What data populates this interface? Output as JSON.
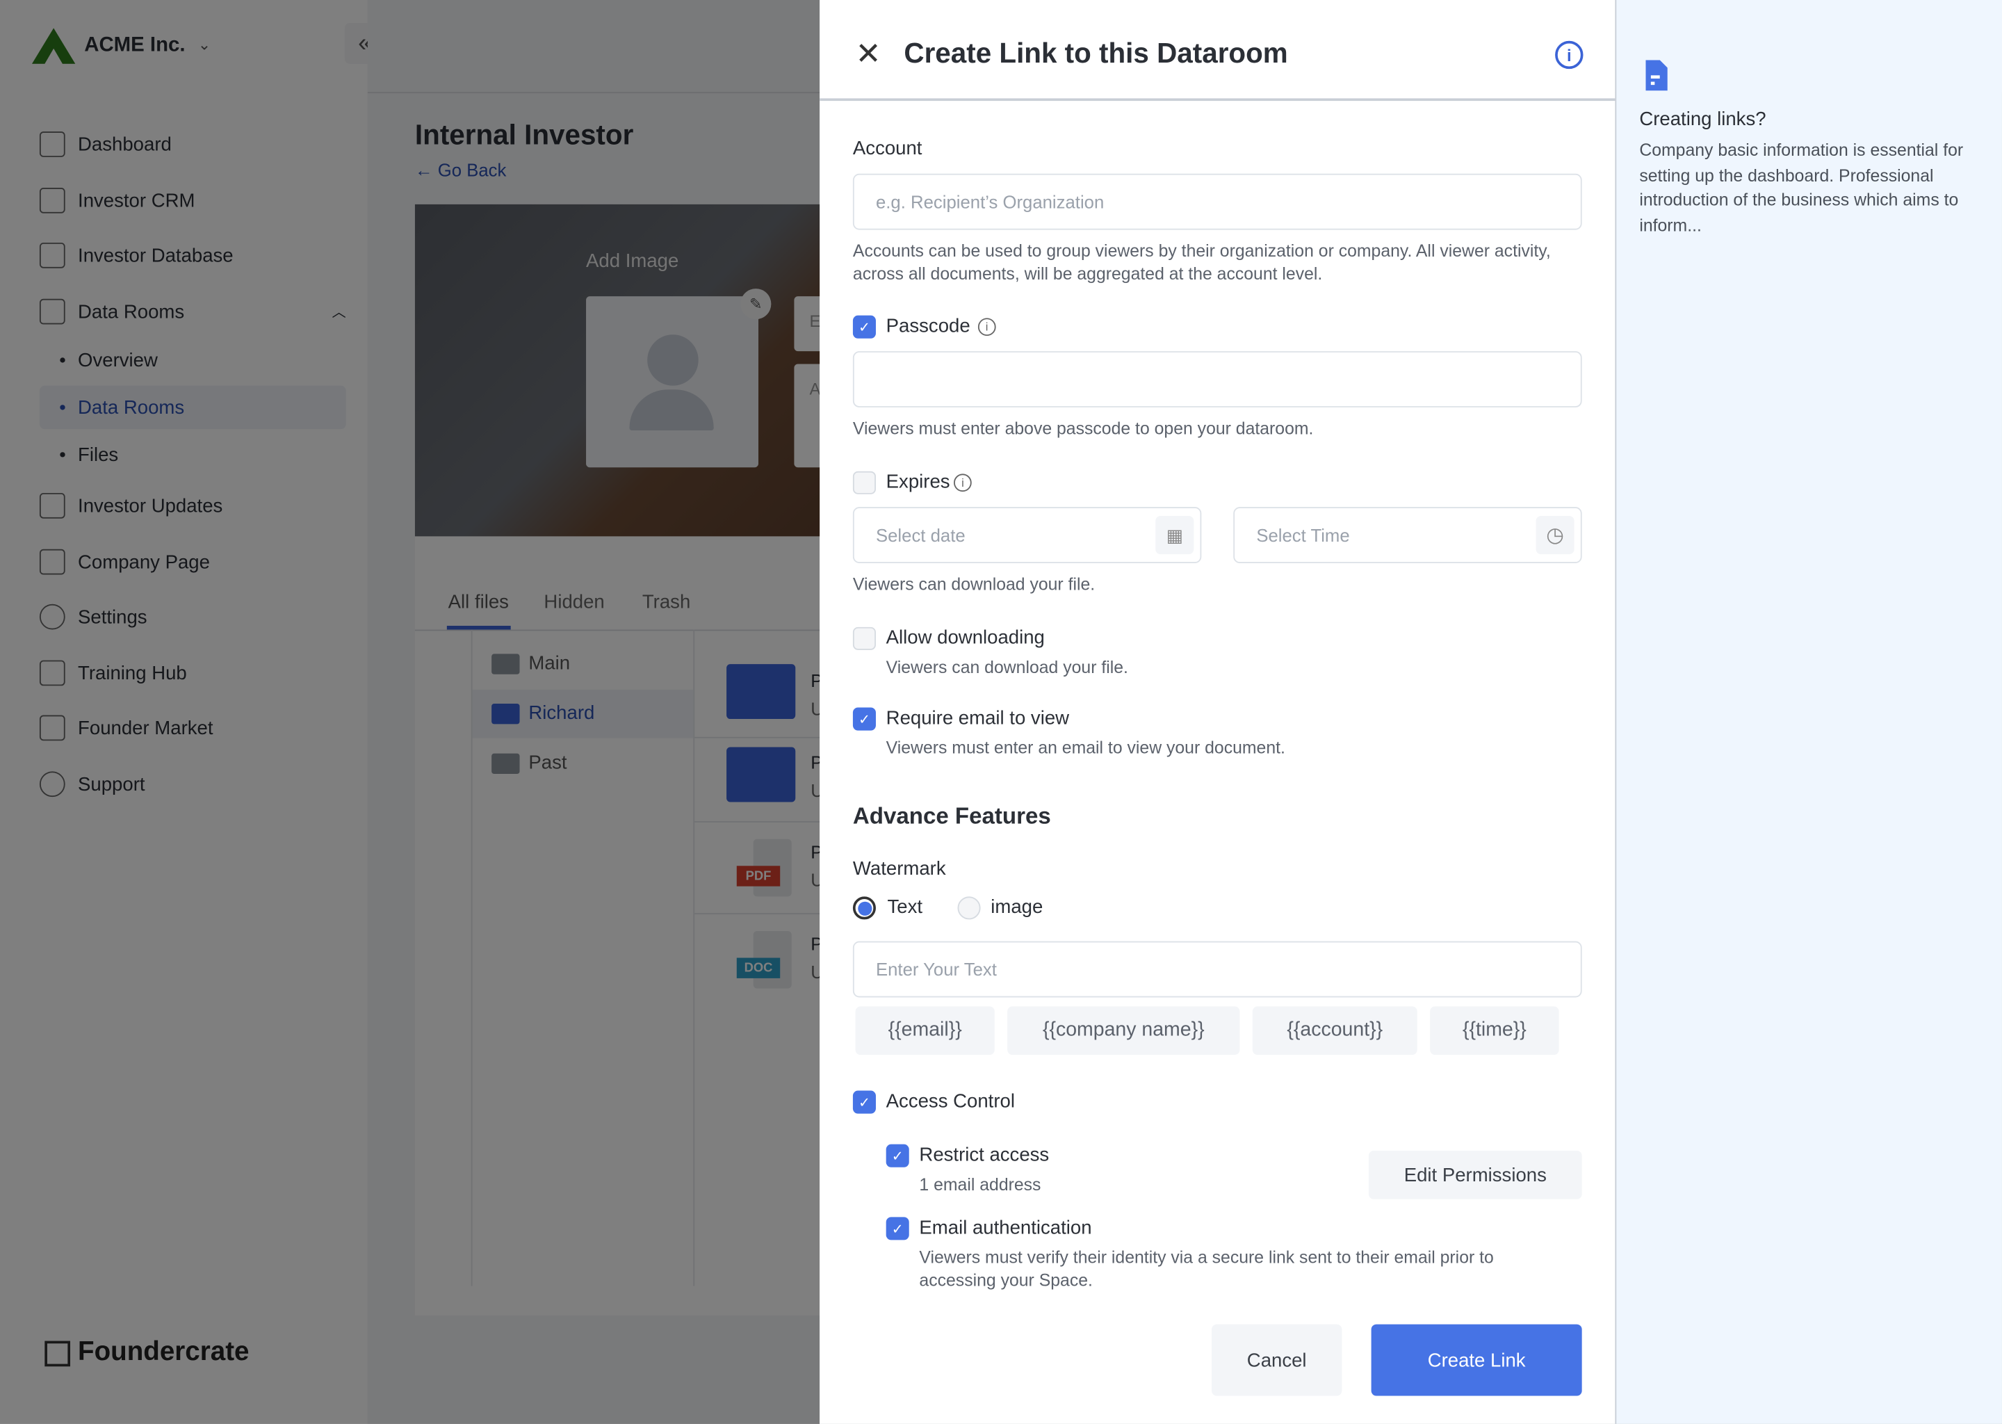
{
  "sidebar": {
    "company": "ACME Inc.",
    "items": [
      {
        "label": "Dashboard",
        "icon": "dashboard-icon"
      },
      {
        "label": "Investor CRM",
        "icon": "presentation-icon"
      },
      {
        "label": "Investor Database",
        "icon": "database-icon"
      },
      {
        "label": "Data Rooms",
        "icon": "building-icon"
      },
      {
        "label": "Investor Updates",
        "icon": "document-check-icon"
      },
      {
        "label": "Company Page",
        "icon": "page-icon"
      },
      {
        "label": "Settings",
        "icon": "gear-icon"
      },
      {
        "label": "Training Hub",
        "icon": "training-icon"
      },
      {
        "label": "Founder Market",
        "icon": "market-icon"
      },
      {
        "label": "Support",
        "icon": "help-icon"
      }
    ],
    "subitems": [
      {
        "label": "Overview"
      },
      {
        "label": "Data Rooms",
        "active": true
      },
      {
        "label": "Files"
      }
    ],
    "brand": "Foundercrate"
  },
  "main": {
    "title": "Internal Investor",
    "go_back": "Go Back",
    "add_image": "Add Image",
    "card_fragments": [
      "E",
      "A"
    ],
    "tabs": [
      "All files",
      "Hidden",
      "Trash"
    ],
    "folders": [
      {
        "label": "Main"
      },
      {
        "label": "Richard",
        "active": true
      },
      {
        "label": "Past"
      }
    ],
    "files": [
      {
        "type": "folder",
        "fragment": "P",
        "sub": "U"
      },
      {
        "type": "folder",
        "fragment": "P",
        "sub": "U"
      },
      {
        "type": "PDF",
        "fragment": "P",
        "sub": "U"
      },
      {
        "type": "DOC",
        "fragment": "P",
        "sub": "U"
      }
    ]
  },
  "modal": {
    "title": "Create Link to this Dataroom",
    "account_label": "Account",
    "account_placeholder": "e.g. Recipient’s Organization",
    "account_help": "Accounts can be used to group viewers by their organization or company. All viewer activity, across all documents, will be aggregated at the account level.",
    "passcode_label": "Passcode",
    "passcode_checked": true,
    "passcode_help": "Viewers must enter above passcode to open your dataroom.",
    "expires_label": "Expires",
    "expires_checked": false,
    "date_placeholder": "Select date",
    "time_placeholder": "Select Time",
    "expires_help": "Viewers can download your file.",
    "download_label": "Allow downloading",
    "download_checked": false,
    "download_help": "Viewers can download your file.",
    "email_label": "Require email to view",
    "email_checked": true,
    "email_help": "Viewers must enter an email to view your document.",
    "advance_title": "Advance Features",
    "watermark_label": "Watermark",
    "watermark_options": [
      "Text",
      "image"
    ],
    "watermark_selected": "Text",
    "watermark_placeholder": "Enter Your Text",
    "chips": [
      "{{email}}",
      "{{company name}}",
      "{{account}}",
      "{{time}}"
    ],
    "access_label": "Access Control",
    "access_checked": true,
    "restrict_label": "Restrict access",
    "restrict_sub": "1 email address",
    "edit_permissions": "Edit Permissions",
    "auth_label": "Email authentication",
    "auth_help": "Viewers must verify their identity via a secure link sent to their email prior to accessing your Space.",
    "cancel": "Cancel",
    "create": "Create Link"
  },
  "info_panel": {
    "title": "Creating links?",
    "text": "Company basic information is essential for setting up the dashboard. Professional introduction of the business which aims to inform..."
  },
  "colors": {
    "accent": "#4673e5",
    "info_bg": "#eff6fe",
    "pdf": "#d9412e",
    "doc": "#2e9fc9"
  }
}
